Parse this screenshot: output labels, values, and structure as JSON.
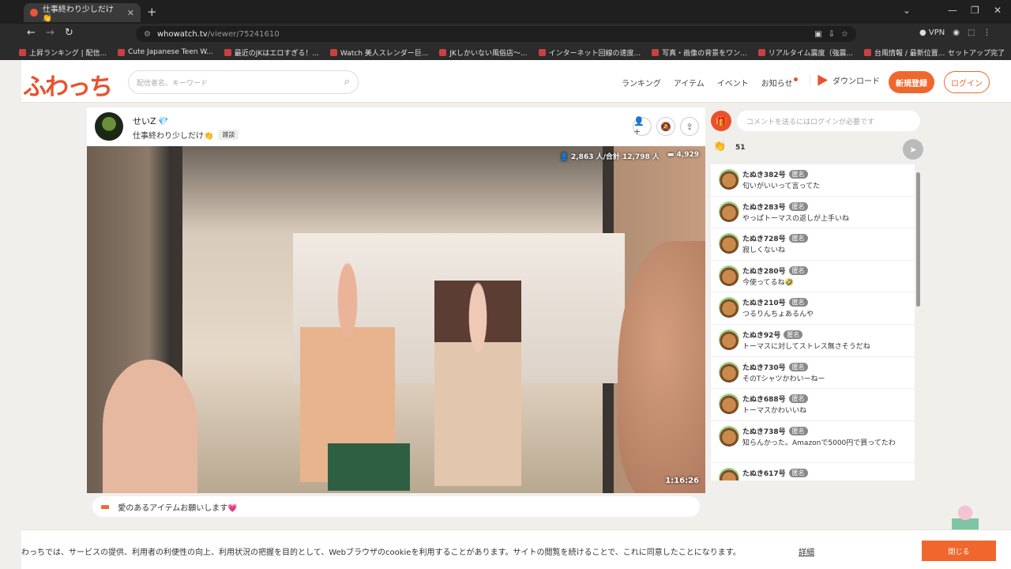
{
  "browser": {
    "tab_title": "仕事終わり少しだけ👏",
    "url_host": "whowatch.tv",
    "url_path": "/viewer/75241610",
    "vpn_label": "VPN",
    "bookmarks": [
      "上昇ランキング | 配信...",
      "Cute Japanese Teen W...",
      "最近のJKはエロすぎる！...",
      "Watch 美人スレンダー巨...",
      "JKしかいない風俗店〜...",
      "インターネット回線の速度...",
      "写真・画像の背景をワン...",
      "リアルタイム震度（強震...",
      "台風情報 / 最新位置..."
    ],
    "bookmark_right": "セットアップ完了"
  },
  "site": {
    "logo": "ふわっち",
    "search_placeholder": "配信者名、キーワード",
    "nav": [
      "ランキング",
      "アイテム",
      "イベント",
      "お知らせ"
    ],
    "download": "ダウンロード",
    "signup": "新規登録",
    "login": "ログイン"
  },
  "stream": {
    "streamer_name": "せいZ",
    "title": "仕事終わり少しだけ👏",
    "category": "雑談",
    "viewers": "2,863 人/合計 12,798 人",
    "comments_count": "4,929",
    "duration": "1:16:26",
    "item_message": "愛のあるアイテムお願いします💗"
  },
  "chat": {
    "input_placeholder": "コメントを送るにはログインが必要です",
    "clap_count": "51",
    "anon_badge": "匿名",
    "messages": [
      {
        "name": "たぬき382号",
        "text": "匂いがいいって言ってた"
      },
      {
        "name": "たぬき283号",
        "text": "やっぱトーマスの返しが上手いね"
      },
      {
        "name": "たぬき728号",
        "text": "寂しくないね"
      },
      {
        "name": "たぬき280号",
        "text": "今使ってるね🤣"
      },
      {
        "name": "たぬき210号",
        "text": "つるりんちょあるんや"
      },
      {
        "name": "たぬき92号",
        "text": "トーマスに対してストレス無さそうだね"
      },
      {
        "name": "たぬき730号",
        "text": "そのTシャツかわいーねー"
      },
      {
        "name": "たぬき688号",
        "text": "トーマスかわいいね"
      },
      {
        "name": "たぬき738号",
        "text": "知らんかった。Amazonで5000円で買ってたわ"
      },
      {
        "name": "たぬき617号",
        "text": ""
      }
    ]
  },
  "cookie": {
    "text": "わっちでは、サービスの提供、利用者の利便性の向上、利用状況の把握を目的として、Webブラウザのcookieを利用することがあります。サイトの閲覧を続けることで、これに同意したことになります。",
    "link": "詳細",
    "close": "閉じる"
  },
  "colors": {
    "accent": "#f0672e",
    "logo": "#e9522c"
  }
}
